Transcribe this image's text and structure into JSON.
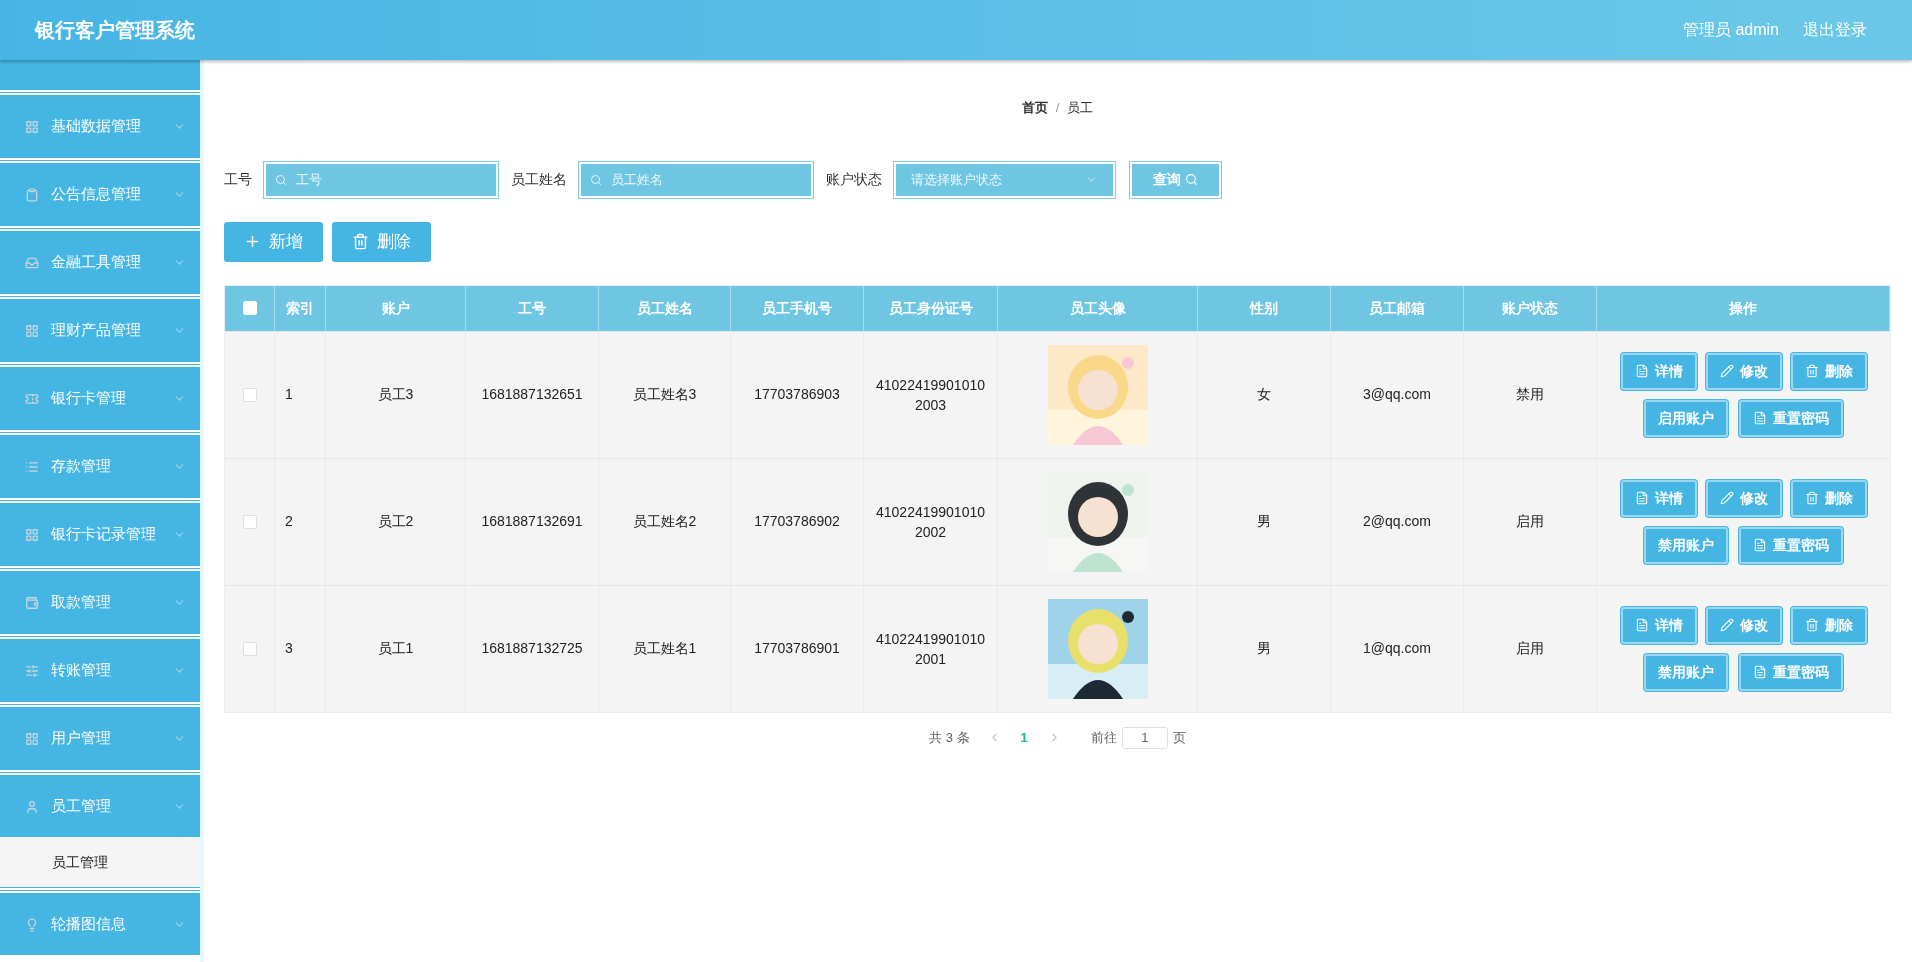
{
  "header": {
    "title": "银行客户管理系统",
    "user": "管理员 admin",
    "logout": "退出登录"
  },
  "sidebar": {
    "items": [
      {
        "label": "基础数据管理"
      },
      {
        "label": "公告信息管理"
      },
      {
        "label": "金融工具管理"
      },
      {
        "label": "理财产品管理"
      },
      {
        "label": "银行卡管理"
      },
      {
        "label": "存款管理"
      },
      {
        "label": "银行卡记录管理"
      },
      {
        "label": "取款管理"
      },
      {
        "label": "转账管理"
      },
      {
        "label": "用户管理"
      },
      {
        "label": "员工管理",
        "children": [
          {
            "label": "员工管理",
            "selected": true
          }
        ]
      },
      {
        "label": "轮播图信息"
      }
    ]
  },
  "breadcrumb": {
    "items": [
      "首页",
      "员工"
    ],
    "separator": "/"
  },
  "search": {
    "fields": [
      {
        "kind": "input",
        "label": "工号",
        "placeholder": "工号"
      },
      {
        "kind": "input",
        "label": "员工姓名",
        "placeholder": "员工姓名"
      },
      {
        "kind": "select",
        "label": "账户状态",
        "placeholder": "请选择账户状态"
      }
    ],
    "button": "查询"
  },
  "toolbar": [
    "新增",
    "删除"
  ],
  "table": {
    "header_checked": false,
    "columns": [
      "索引",
      "账户",
      "工号",
      "员工姓名",
      "员工手机号",
      "员工身份证号",
      "员工头像",
      "性别",
      "员工邮箱",
      "账户状态",
      "操作"
    ],
    "rows": [
      {
        "checked": false,
        "index": "1",
        "account": "员工3",
        "number": "1681887132651",
        "name": "员工姓名3",
        "phone": "17703786903",
        "id_card": "410224199010102003",
        "gender": "女",
        "email": "3@qq.com",
        "status": "禁用",
        "actions": [
          "详情",
          "修改",
          "删除",
          "启用账户",
          "重置密码"
        ]
      },
      {
        "checked": false,
        "index": "2",
        "account": "员工2",
        "number": "1681887132691",
        "name": "员工姓名2",
        "phone": "17703786902",
        "id_card": "410224199010102002",
        "gender": "男",
        "email": "2@qq.com",
        "status": "启用",
        "actions": [
          "详情",
          "修改",
          "删除",
          "禁用账户",
          "重置密码"
        ]
      },
      {
        "checked": false,
        "index": "3",
        "account": "员工1",
        "number": "1681887132725",
        "name": "员工姓名1",
        "phone": "17703786901",
        "id_card": "410224199010102001",
        "gender": "男",
        "email": "1@qq.com",
        "status": "启用",
        "actions": [
          "详情",
          "修改",
          "删除",
          "禁用账户",
          "重置密码"
        ]
      }
    ]
  },
  "pagination": {
    "total": "共 3 条",
    "pages": [
      {
        "label": "1",
        "selected": true
      }
    ],
    "goto": "前往",
    "goto_value": "1",
    "suffix": "页"
  }
}
